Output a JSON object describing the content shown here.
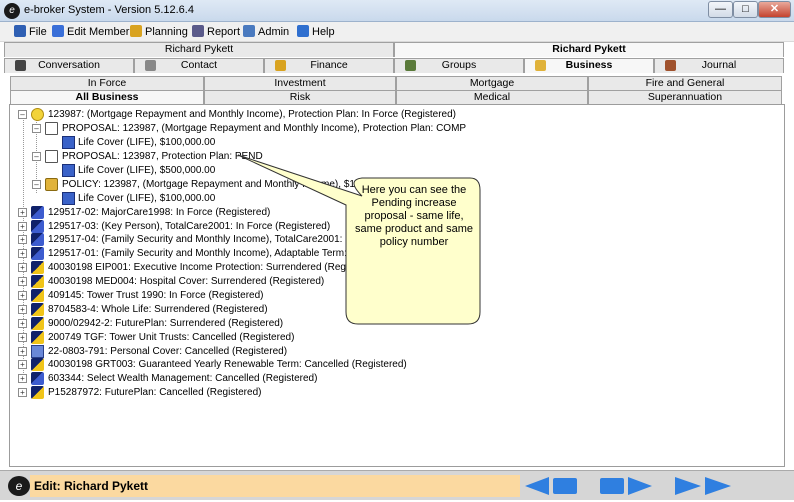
{
  "window": {
    "title": "e-broker System - Version 5.12.6.4"
  },
  "menu": {
    "items": [
      {
        "label": "File",
        "icon": "file-icon",
        "color": "#2f5fb3"
      },
      {
        "label": "Edit Member",
        "icon": "member-icon",
        "color": "#3a6fd8"
      },
      {
        "label": "Planning",
        "icon": "planning-icon",
        "color": "#d9a320"
      },
      {
        "label": "Report",
        "icon": "report-icon",
        "color": "#5a5a8a"
      },
      {
        "label": "Admin",
        "icon": "admin-icon",
        "color": "#4a7abf"
      },
      {
        "label": "Help",
        "icon": "help-icon",
        "color": "#2f6fcf"
      }
    ]
  },
  "member_tabs": {
    "left": "Richard Pykett",
    "right": "Richard Pykett"
  },
  "section_tabs": [
    "Conversation",
    "Contact",
    "Finance",
    "Groups",
    "Business",
    "Journal"
  ],
  "business_tabs": {
    "row1": [
      "In Force",
      "Investment",
      "Mortgage",
      "Fire and General"
    ],
    "row2": [
      "All Business",
      "Risk",
      "Medical",
      "Superannuation"
    ]
  },
  "tree": [
    {
      "text": "123987: (Mortgage Repayment and Monthly Income), Protection Plan: In Force (Registered)",
      "icon": "sun-icon"
    },
    {
      "text": "PROPOSAL: 123987, (Mortgage Repayment and Monthly Income), Protection Plan: COMP",
      "icon": "proposal-doc-icon"
    },
    {
      "text": "Life Cover (LIFE), $100,000.00",
      "icon": "cover-icon"
    },
    {
      "text": "PROPOSAL: 123987, Protection Plan: PEND",
      "icon": "proposal-doc-icon"
    },
    {
      "text": "Life Cover (LIFE), $500,000.00",
      "icon": "cover-icon"
    },
    {
      "text": "POLICY: 123987, (Mortgage Repayment and Monthly Income), $100,000 PER Mo",
      "icon": "policy-stamp-icon"
    },
    {
      "text": "Life Cover (LIFE), $100,000.00",
      "icon": "cover-icon"
    },
    {
      "text": "129517-02: MajorCare1998: In Force (Registered)",
      "icon": "policy-icon"
    },
    {
      "text": "129517-03: (Key Person), TotalCare2001: In Force (Registered)",
      "icon": "policy-icon"
    },
    {
      "text": "129517-04: (Family Security and Monthly Income), TotalCare2001: In Force (Registered)",
      "icon": "policy-icon"
    },
    {
      "text": "129517-01: (Family Security and Monthly Income), Adaptable Term: Lapsed (Registered)",
      "icon": "policy-icon"
    },
    {
      "text": "40030198 EIP001: Executive Income Protection: Surrendered (Registered)",
      "icon": "policy-yellow-icon"
    },
    {
      "text": "40030198 MED004: Hospital Cover: Surrendered (Registered)",
      "icon": "policy-yellow-icon"
    },
    {
      "text": "409145: Tower Trust 1990: In Force (Registered)",
      "icon": "policy-yellow-icon"
    },
    {
      "text": "8704583-4: Whole Life: Surrendered (Registered)",
      "icon": "policy-yellow-icon"
    },
    {
      "text": "9000/02942-2: FuturePlan: Surrendered (Registered)",
      "icon": "policy-yellow-icon"
    },
    {
      "text": "200749 TGF: Tower Unit Trusts: Cancelled (Registered)",
      "icon": "policy-yellow-icon"
    },
    {
      "text": "22-0803-791: Personal Cover: Cancelled (Registered)",
      "icon": "card-icon"
    },
    {
      "text": "40030198 GRT003: Guaranteed Yearly Renewable Term: Cancelled (Registered)",
      "icon": "policy-yellow-icon"
    },
    {
      "text": "603344: Select Wealth Management: Cancelled (Registered)",
      "icon": "policy-icon"
    },
    {
      "text": "P15287972: FuturePlan: Cancelled (Registered)",
      "icon": "policy-yellow-icon"
    }
  ],
  "callout": {
    "text": "Here you can see the Pending increase proposal - same life, same product and same policy number"
  },
  "status": {
    "edit_label": "Edit: Richard Pykett"
  },
  "colors": {
    "status_bg": "#fbd9a0",
    "nav_blue": "#2f7fe0",
    "callout_bg": "#ffffcc"
  }
}
